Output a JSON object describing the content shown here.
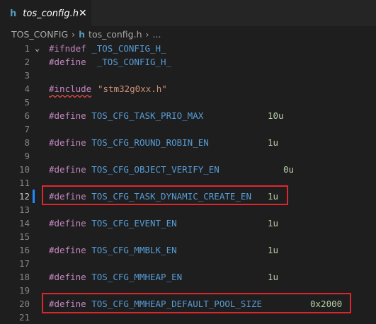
{
  "tab": {
    "label": "tos_config.h",
    "icon": "h",
    "close": "✕"
  },
  "breadcrumb": {
    "folder": "TOS_CONFIG",
    "file_icon": "h",
    "file": "tos_config.h",
    "more": "...",
    "separator": "›"
  },
  "fold_glyph": "⌄",
  "lines": [
    {
      "n": "1",
      "d": "#ifndef",
      "name": " _TOS_CONFIG_H_",
      "val": ""
    },
    {
      "n": "2",
      "d": "#define",
      "name": "  _TOS_CONFIG_H_",
      "val": ""
    },
    {
      "n": "3",
      "d": "",
      "name": "",
      "val": ""
    },
    {
      "n": "4",
      "d": "#include",
      "name": "",
      "val": "\"stm32g0xx.h\""
    },
    {
      "n": "5",
      "d": "",
      "name": "",
      "val": ""
    },
    {
      "n": "6",
      "d": "#define",
      "name": " TOS_CFG_TASK_PRIO_MAX",
      "val": "10u"
    },
    {
      "n": "7",
      "d": "",
      "name": "",
      "val": ""
    },
    {
      "n": "8",
      "d": "#define",
      "name": " TOS_CFG_ROUND_ROBIN_EN",
      "val": "1u"
    },
    {
      "n": "9",
      "d": "",
      "name": "",
      "val": ""
    },
    {
      "n": "10",
      "d": "#define",
      "name": " TOS_CFG_OBJECT_VERIFY_EN",
      "val": "0u"
    },
    {
      "n": "11",
      "d": "",
      "name": "",
      "val": ""
    },
    {
      "n": "12",
      "d": "#define",
      "name": " TOS_CFG_TASK_DYNAMIC_CREATE_EN",
      "val": "1u"
    },
    {
      "n": "13",
      "d": "",
      "name": "",
      "val": ""
    },
    {
      "n": "14",
      "d": "#define",
      "name": " TOS_CFG_EVENT_EN",
      "val": "1u"
    },
    {
      "n": "15",
      "d": "",
      "name": "",
      "val": ""
    },
    {
      "n": "16",
      "d": "#define",
      "name": " TOS_CFG_MMBLK_EN",
      "val": "1u"
    },
    {
      "n": "17",
      "d": "",
      "name": "",
      "val": ""
    },
    {
      "n": "18",
      "d": "#define",
      "name": " TOS_CFG_MMHEAP_EN",
      "val": "1u"
    },
    {
      "n": "19",
      "d": "",
      "name": "",
      "val": ""
    },
    {
      "n": "20",
      "d": "#define",
      "name": " TOS_CFG_MMHEAP_DEFAULT_POOL_SIZE",
      "val": "0x2000"
    },
    {
      "n": "21",
      "d": "",
      "name": "",
      "val": ""
    }
  ],
  "colors": {
    "highlight_border": "#e0262d",
    "directive": "#c586c0",
    "macro": "#569cd6",
    "number": "#b5cea8",
    "string": "#ce9178"
  }
}
